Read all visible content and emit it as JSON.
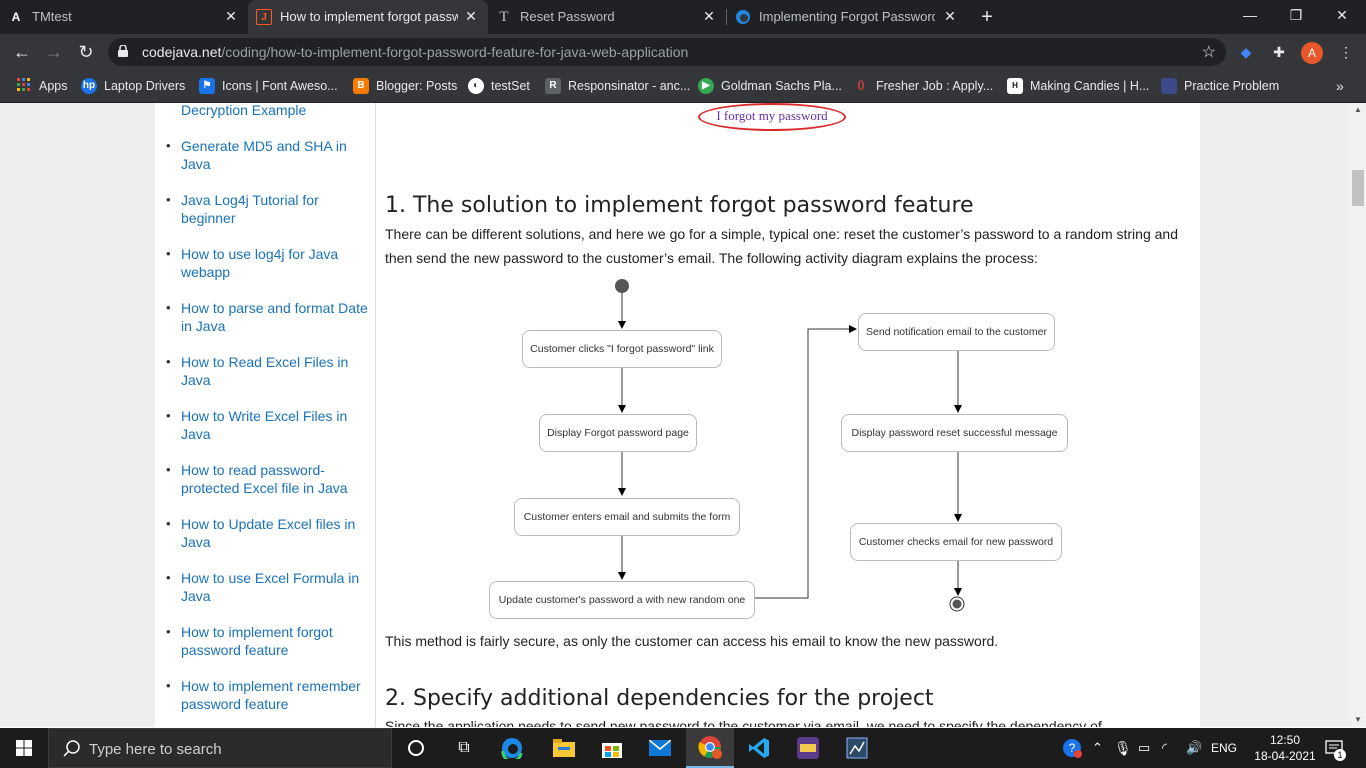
{
  "tabs": [
    {
      "label": "TMtest",
      "icon": "A"
    },
    {
      "label": "How to implement forgot passw",
      "icon": "J"
    },
    {
      "label": "Reset Password",
      "icon": "T"
    },
    {
      "label": "Implementing Forgot Password fo",
      "icon": "edge"
    }
  ],
  "window": {
    "minimize": "—",
    "restore": "❐",
    "close": "✕"
  },
  "address": {
    "host": "codejava.net",
    "path": "/coding/how-to-implement-forgot-password-feature-for-java-web-application"
  },
  "profile_initial": "A",
  "bookmarks": [
    {
      "label": "Apps",
      "color": "#ea4335"
    },
    {
      "label": "Laptop Drivers",
      "color": "#1a73e8"
    },
    {
      "label": "Icons | Font Aweso...",
      "color": "#1a73e8"
    },
    {
      "label": "Blogger: Posts",
      "color": "#f57c00"
    },
    {
      "label": "testSet",
      "color": "#fff"
    },
    {
      "label": "Responsinator - anc...",
      "color": "#5f6368"
    },
    {
      "label": "Goldman Sachs Pla...",
      "color": "#34a853"
    },
    {
      "label": "Fresher Job : Apply...",
      "color": "#ea4335"
    },
    {
      "label": "Making Candies | H...",
      "color": "#111"
    },
    {
      "label": "Practice Problem",
      "color": "#3c4a8a"
    }
  ],
  "sidebar": {
    "items": [
      {
        "label": "Decryption Example"
      },
      {
        "label": "Generate MD5 and SHA in Java"
      },
      {
        "label": "Java Log4j Tutorial for beginner"
      },
      {
        "label": "How to use log4j for Java webapp"
      },
      {
        "label": "How to parse and format Date in Java"
      },
      {
        "label": "How to Read Excel Files in Java"
      },
      {
        "label": "How to Write Excel Files in Java"
      },
      {
        "label": "How to read password-protected Excel file in Java"
      },
      {
        "label": "How to Update Excel files in Java"
      },
      {
        "label": "How to use Excel Formula in Java"
      },
      {
        "label": "How to implement forgot password feature"
      },
      {
        "label": "How to implement remember password feature"
      }
    ]
  },
  "content": {
    "forgot_link": "I forgot my password",
    "heading1": "1. The solution to implement forgot password feature",
    "para1": "There can be different solutions, and here we go for a simple, typical one: reset the customer’s password to a random string and then send the new password to the customer’s email. The following activity diagram explains the process:",
    "diagram_nodes": [
      "Customer clicks \"I forgot password\" link",
      "Display Forgot password page",
      "Customer enters email and submits the form",
      "Update customer's password a with new random one",
      "Send notification email to the customer",
      "Display password reset successful message",
      "Customer checks email for new password"
    ],
    "para2": "This method is fairly secure, as only the customer can access his email to know the new password.",
    "heading2": "2. Specify additional dependencies for the project",
    "para3": "Since the application needs to send new password to the customer via email, we need to specify the dependency of"
  },
  "taskbar": {
    "search_placeholder": "Type here to search",
    "language": "ENG",
    "time": "12:50",
    "date": "18-04-2021",
    "notification_count": "1"
  }
}
